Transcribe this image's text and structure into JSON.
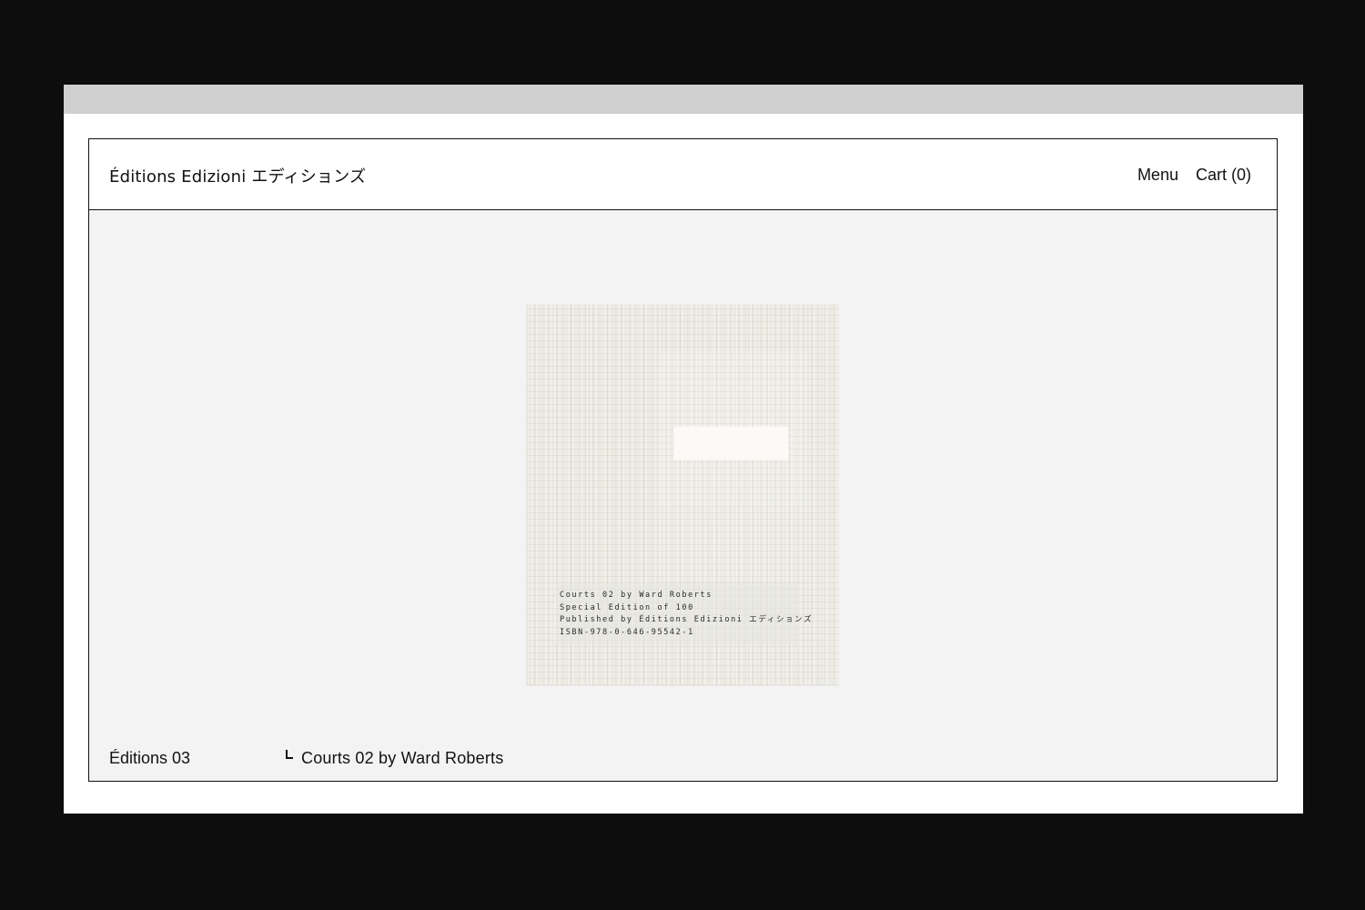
{
  "site": {
    "brand": "Éditions Edizioni エディションズ",
    "nav": {
      "menu": "Menu",
      "cart": "Cart (0)"
    }
  },
  "product": {
    "cover_text": [
      "Courts 02 by Ward Roberts",
      "Special Edition of 100",
      "Published by Éditions Edizioni エディションズ",
      "ISBN-978-0-646-95542-1"
    ]
  },
  "footer": {
    "collection": "Éditions 03",
    "breadcrumb_icon": "corner-arrow-icon",
    "title": "Courts 02 by Ward Roberts"
  }
}
